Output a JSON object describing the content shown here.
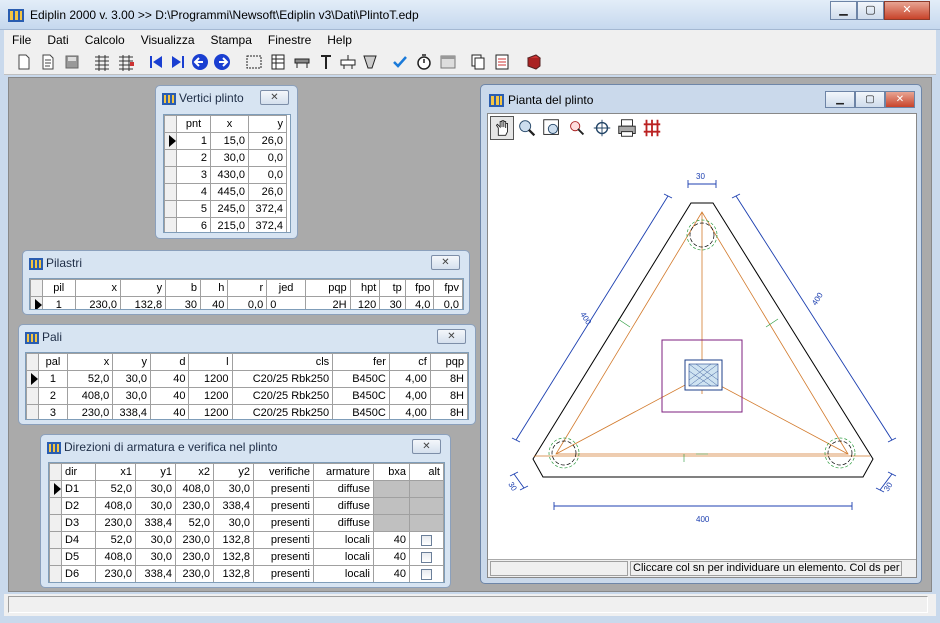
{
  "window": {
    "title": "Ediplin 2000 v. 3.00 >> D:\\Programmi\\Newsoft\\Ediplin v3\\Dati\\PlintoT.edp",
    "min_label": "▁",
    "max_label": "▢",
    "close_label": "✕"
  },
  "menu": [
    "File",
    "Dati",
    "Calcolo",
    "Visualizza",
    "Stampa",
    "Finestre",
    "Help"
  ],
  "vertici": {
    "title": "Vertici plinto",
    "close_label": "✕",
    "headers": [
      "pnt",
      "x",
      "y"
    ],
    "rows": [
      [
        "1",
        "15,0",
        "26,0"
      ],
      [
        "2",
        "30,0",
        "0,0"
      ],
      [
        "3",
        "430,0",
        "0,0"
      ],
      [
        "4",
        "445,0",
        "26,0"
      ],
      [
        "5",
        "245,0",
        "372,4"
      ],
      [
        "6",
        "215,0",
        "372,4"
      ]
    ]
  },
  "pilastri": {
    "title": "Pilastri",
    "close_label": "✕",
    "headers": [
      "pil",
      "x",
      "y",
      "b",
      "h",
      "r",
      "jed",
      "pqp",
      "hpt",
      "tp",
      "fpo",
      "fpv"
    ],
    "rows": [
      [
        "1",
        "230,0",
        "132,8",
        "30",
        "40",
        "0,0",
        "0",
        "2H",
        "120",
        "30",
        "4,0",
        "0,0"
      ]
    ]
  },
  "pali": {
    "title": "Pali",
    "close_label": "✕",
    "headers": [
      "pal",
      "x",
      "y",
      "d",
      "l",
      "cls",
      "fer",
      "cf",
      "pqp"
    ],
    "rows": [
      [
        "1",
        "52,0",
        "30,0",
        "40",
        "1200",
        "C20/25 Rbk250",
        "B450C",
        "4,00",
        "8H"
      ],
      [
        "2",
        "408,0",
        "30,0",
        "40",
        "1200",
        "C20/25 Rbk250",
        "B450C",
        "4,00",
        "8H"
      ],
      [
        "3",
        "230,0",
        "338,4",
        "40",
        "1200",
        "C20/25 Rbk250",
        "B450C",
        "4,00",
        "8H"
      ]
    ]
  },
  "direzioni": {
    "title": "Direzioni di armatura e verifica nel plinto",
    "close_label": "✕",
    "headers": [
      "dir",
      "x1",
      "y1",
      "x2",
      "y2",
      "verifiche",
      "armature",
      "bxa",
      "alt"
    ],
    "rows": [
      [
        "D1",
        "52,0",
        "30,0",
        "408,0",
        "30,0",
        "presenti",
        "diffuse",
        "",
        ""
      ],
      [
        "D2",
        "408,0",
        "30,0",
        "230,0",
        "338,4",
        "presenti",
        "diffuse",
        "",
        ""
      ],
      [
        "D3",
        "230,0",
        "338,4",
        "52,0",
        "30,0",
        "presenti",
        "diffuse",
        "",
        ""
      ],
      [
        "D4",
        "52,0",
        "30,0",
        "230,0",
        "132,8",
        "presenti",
        "locali",
        "40",
        "chk"
      ],
      [
        "D5",
        "408,0",
        "30,0",
        "230,0",
        "132,8",
        "presenti",
        "locali",
        "40",
        "chk"
      ],
      [
        "D6",
        "230,0",
        "338,4",
        "230,0",
        "132,8",
        "presenti",
        "locali",
        "40",
        "chk"
      ]
    ]
  },
  "pianta": {
    "title": "Pianta del plinto",
    "status": "Cliccare col sn per individuare un elemento. Col ds per sp",
    "dims": {
      "top": "30",
      "left": "400",
      "right": "400",
      "bottom": "400",
      "bl": "30",
      "br": "30"
    }
  }
}
